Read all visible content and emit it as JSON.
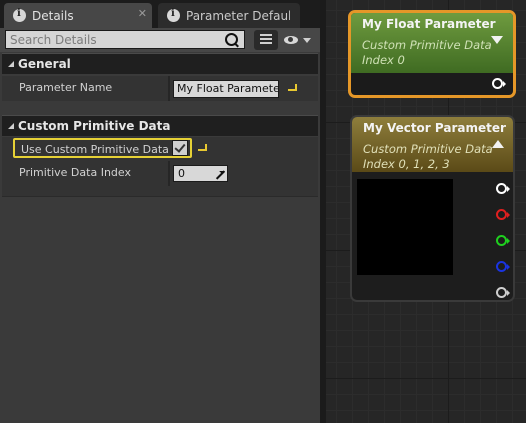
{
  "details_panel": {
    "tabs": [
      {
        "label": "Details",
        "icon": "info-icon",
        "close": "✕",
        "active": true
      },
      {
        "label": "Parameter Defaults",
        "icon": "info-icon",
        "active": false
      }
    ],
    "search": {
      "placeholder": "Search Details",
      "value": ""
    },
    "sections": {
      "general": {
        "title": "General",
        "properties": [
          {
            "label": "Parameter Name",
            "value": "My Float Parameter"
          }
        ]
      },
      "custom_primitive_data": {
        "title": "Custom Primitive Data",
        "properties": [
          {
            "label": "Use Custom Primitive Data",
            "checked": true
          },
          {
            "label": "Primitive Data Index",
            "value": "0"
          }
        ]
      }
    },
    "highlight_color": "#e6d136"
  },
  "graph": {
    "nodes": [
      {
        "title": "My Float Parameter",
        "subtitle": "Custom Primitive Data Index 0",
        "header_color": "#5e8a35",
        "selected": true,
        "selection_color": "#e59728",
        "pins": [
          "output-white"
        ]
      },
      {
        "title": "My Vector Parameter",
        "subtitle": "Custom Primitive Data Index 0, 1, 2, 3",
        "header_color": "#7d6b2c",
        "preview_color": "#000000",
        "pins": [
          {
            "channel": "rgba",
            "color": "#ffffff"
          },
          {
            "channel": "r",
            "color": "#e01f1f"
          },
          {
            "channel": "g",
            "color": "#1fd01f"
          },
          {
            "channel": "b",
            "color": "#1a34e0"
          },
          {
            "channel": "a",
            "color": "#cfcfcf"
          }
        ]
      }
    ]
  }
}
